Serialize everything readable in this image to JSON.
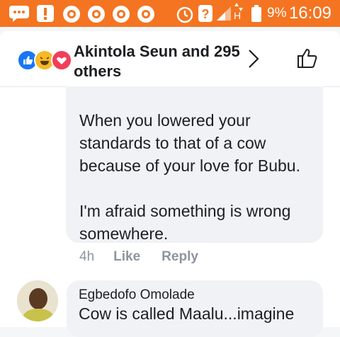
{
  "status_bar": {
    "icons": [
      "messages-icon",
      "alert-icon",
      "app-icon",
      "app-icon",
      "app-icon",
      "app-icon",
      "alarm-icon",
      "unknown-sim-icon",
      "signal-icon",
      "data-icon",
      "battery-icon"
    ],
    "network": "H",
    "battery": "9%",
    "time": "16:09",
    "background_color": "#f47421"
  },
  "header": {
    "reactions": [
      "like-reaction",
      "haha-reaction",
      "love-reaction"
    ],
    "title": "Akintola Seun and 295 others"
  },
  "comment1": {
    "text": "When you lowered your standards to that of a cow because of your love for Bubu.\n\nI'm afraid something is wrong somewhere.",
    "time": "4h",
    "like_label": "Like",
    "reply_label": "Reply"
  },
  "comment2": {
    "author": "Egbedofo Omolade",
    "text": "Cow is called Maalu...imagine"
  }
}
